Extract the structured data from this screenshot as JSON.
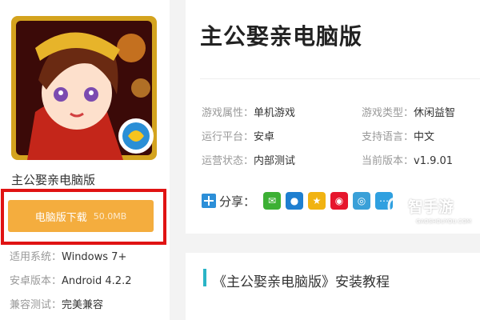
{
  "app": {
    "name": "主公娶亲电脑版",
    "download_label": "电脑版下载",
    "download_size": "50.0MB"
  },
  "specs": [
    {
      "key": "适用系统：",
      "value": "Windows 7+"
    },
    {
      "key": "安卓版本：",
      "value": "Android 4.2.2"
    },
    {
      "key": "兼容测试：",
      "value": "完美兼容"
    }
  ],
  "title": "主公娶亲电脑版",
  "attributes": [
    {
      "key": "游戏属性：",
      "value": "单机游戏"
    },
    {
      "key": "游戏类型：",
      "value": "休闲益智"
    },
    {
      "key": "运行平台：",
      "value": "安卓"
    },
    {
      "key": "支持语言：",
      "value": "中文"
    },
    {
      "key": "运营状态：",
      "value": "内部测试"
    },
    {
      "key": "当前版本：",
      "value": "v1.9.01"
    }
  ],
  "share": {
    "label": "分享：",
    "targets": [
      {
        "name": "wechat-icon",
        "color": "#3cb034"
      },
      {
        "name": "qq-icon",
        "color": "#1e7fd0"
      },
      {
        "name": "qzone-icon",
        "color": "#f1b312"
      },
      {
        "name": "weibo-icon",
        "color": "#e6162d"
      },
      {
        "name": "tencent-weibo-icon",
        "color": "#3aa0d8"
      },
      {
        "name": "more-share-icon",
        "color": "#2fa0e0"
      }
    ]
  },
  "tutorial": "《主公娶亲电脑版》安装教程",
  "watermark": {
    "text": "智手游",
    "sub": "GAOSHOUYOU.COM"
  }
}
